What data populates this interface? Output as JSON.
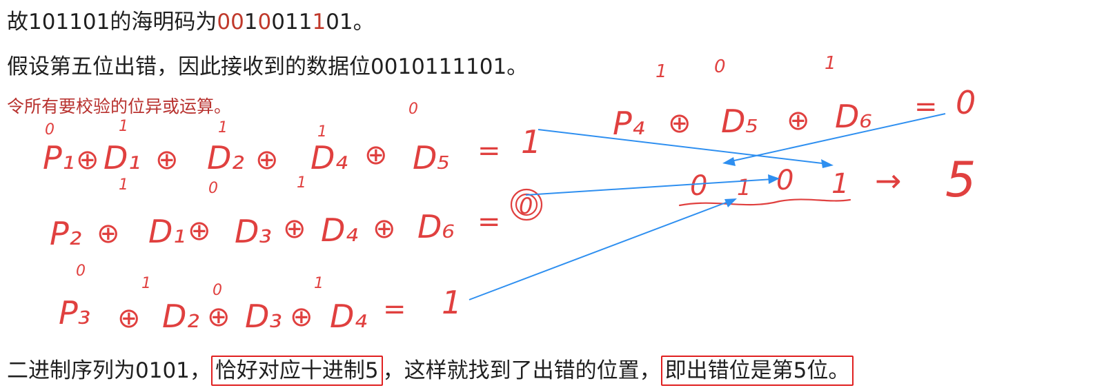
{
  "line1": {
    "prefix": "故101101的海明码为",
    "code_parts": [
      {
        "text": "00",
        "red": true
      },
      {
        "text": "1",
        "red": false
      },
      {
        "text": "0",
        "red": true
      },
      {
        "text": "011",
        "red": false
      },
      {
        "text": "1",
        "red": true
      },
      {
        "text": "01",
        "red": false
      }
    ],
    "suffix": "。"
  },
  "line2": "假设第五位出错，因此接收到的数据位0010111101。",
  "line3": "令所有要校验的位异或运算。",
  "line4": {
    "part1": "二进制序列为0101，",
    "boxed1": "恰好对应十进制5",
    "part2": "，这样就找到了出错的位置，",
    "boxed2": "即出错位是第5位。"
  },
  "handwriting": {
    "eq1": {
      "terms": [
        "P₁",
        "⊕",
        "D₁",
        "⊕",
        "D₂",
        "⊕",
        "D₄",
        "⊕",
        "D₅"
      ],
      "result": "1",
      "bits": [
        "0",
        "1",
        "1",
        "1",
        "0"
      ]
    },
    "eq2": {
      "terms": [
        "P₂",
        "⊕",
        "D₁",
        "⊕",
        "D₃",
        "⊕",
        "D₄",
        "⊕",
        "D₆"
      ],
      "result": "0",
      "bits": [
        "1",
        "0",
        "1"
      ]
    },
    "eq3": {
      "terms": [
        "P₃",
        "⊕",
        "D₂",
        "⊕",
        "D₃",
        "⊕",
        "D₄"
      ],
      "result": "1",
      "bits": [
        "0",
        "1",
        "0",
        "1"
      ]
    },
    "eq4": {
      "terms": [
        "P₄",
        "⊕",
        "D₅",
        "⊕",
        "D₆"
      ],
      "result": "0",
      "bits": [
        "1",
        "0",
        "1"
      ]
    },
    "result_bits": [
      "0",
      "1",
      "0",
      "1"
    ],
    "arrow": "→",
    "decimal": "5"
  },
  "colors": {
    "text": "#1f1f1f",
    "accent_red": "#c0392b",
    "ink": "#e0403f",
    "arrow": "#2e8ff0",
    "box": "#e02020"
  }
}
